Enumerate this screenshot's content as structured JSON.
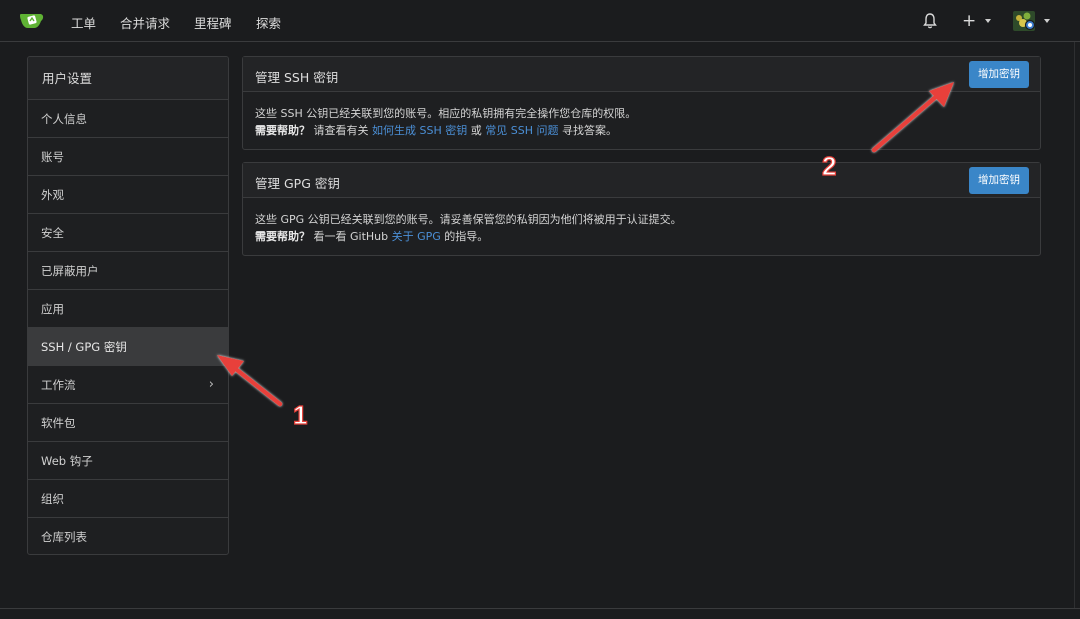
{
  "nav": {
    "items": [
      "工单",
      "合并请求",
      "里程碑",
      "探索"
    ],
    "plus": "+"
  },
  "sidebar": {
    "title": "用户设置",
    "items": [
      {
        "label": "个人信息"
      },
      {
        "label": "账号"
      },
      {
        "label": "外观"
      },
      {
        "label": "安全"
      },
      {
        "label": "已屏蔽用户"
      },
      {
        "label": "应用"
      },
      {
        "label": "SSH / GPG 密钥",
        "active": true
      },
      {
        "label": "工作流",
        "chevron": true
      },
      {
        "label": "软件包"
      },
      {
        "label": "Web 钩子"
      },
      {
        "label": "组织"
      },
      {
        "label": "仓库列表"
      }
    ]
  },
  "ssh": {
    "title": "管理 SSH 密钥",
    "button": "增加密钥",
    "line1": "这些 SSH 公钥已经关联到您的账号。相应的私钥拥有完全操作您仓库的权限。",
    "help_label": "需要帮助？",
    "help_pre": " 请查看有关 ",
    "link1": "如何生成 SSH 密钥",
    "mid": " 或 ",
    "link2": "常见 SSH 问题",
    "help_post": " 寻找答案。"
  },
  "gpg": {
    "title": "管理 GPG 密钥",
    "button": "增加密钥",
    "line1": "这些 GPG 公钥已经关联到您的账号。请妥善保管您的私钥因为他们将被用于认证提交。",
    "help_label": "需要帮助？",
    "help_pre": " 看一看 GitHub ",
    "link1": "关于 GPG",
    "help_post": " 的指导。"
  },
  "annotations": {
    "one": "1",
    "two": "2",
    "color": "#e8413a"
  },
  "colors": {
    "background": "#1b1c1e",
    "accent": "#3a86c8",
    "link": "#4b8fd6",
    "active_item": "#3a3b3d"
  },
  "icons": [
    "gitea-logo-icon",
    "bell-icon",
    "plus-icon",
    "avatar-icon",
    "chevron-right-icon",
    "caret-down-icon"
  ]
}
